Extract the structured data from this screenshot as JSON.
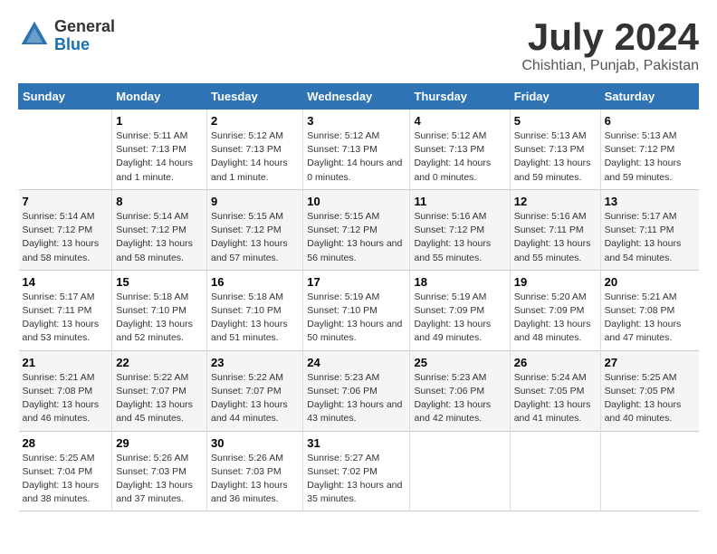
{
  "logo": {
    "general": "General",
    "blue": "Blue"
  },
  "title": {
    "month": "July 2024",
    "location": "Chishtian, Punjab, Pakistan"
  },
  "headers": [
    "Sunday",
    "Monday",
    "Tuesday",
    "Wednesday",
    "Thursday",
    "Friday",
    "Saturday"
  ],
  "weeks": [
    [
      {
        "num": "",
        "sunrise": "",
        "sunset": "",
        "daylight": ""
      },
      {
        "num": "1",
        "sunrise": "Sunrise: 5:11 AM",
        "sunset": "Sunset: 7:13 PM",
        "daylight": "Daylight: 14 hours and 1 minute."
      },
      {
        "num": "2",
        "sunrise": "Sunrise: 5:12 AM",
        "sunset": "Sunset: 7:13 PM",
        "daylight": "Daylight: 14 hours and 1 minute."
      },
      {
        "num": "3",
        "sunrise": "Sunrise: 5:12 AM",
        "sunset": "Sunset: 7:13 PM",
        "daylight": "Daylight: 14 hours and 0 minutes."
      },
      {
        "num": "4",
        "sunrise": "Sunrise: 5:12 AM",
        "sunset": "Sunset: 7:13 PM",
        "daylight": "Daylight: 14 hours and 0 minutes."
      },
      {
        "num": "5",
        "sunrise": "Sunrise: 5:13 AM",
        "sunset": "Sunset: 7:13 PM",
        "daylight": "Daylight: 13 hours and 59 minutes."
      },
      {
        "num": "6",
        "sunrise": "Sunrise: 5:13 AM",
        "sunset": "Sunset: 7:12 PM",
        "daylight": "Daylight: 13 hours and 59 minutes."
      }
    ],
    [
      {
        "num": "7",
        "sunrise": "Sunrise: 5:14 AM",
        "sunset": "Sunset: 7:12 PM",
        "daylight": "Daylight: 13 hours and 58 minutes."
      },
      {
        "num": "8",
        "sunrise": "Sunrise: 5:14 AM",
        "sunset": "Sunset: 7:12 PM",
        "daylight": "Daylight: 13 hours and 58 minutes."
      },
      {
        "num": "9",
        "sunrise": "Sunrise: 5:15 AM",
        "sunset": "Sunset: 7:12 PM",
        "daylight": "Daylight: 13 hours and 57 minutes."
      },
      {
        "num": "10",
        "sunrise": "Sunrise: 5:15 AM",
        "sunset": "Sunset: 7:12 PM",
        "daylight": "Daylight: 13 hours and 56 minutes."
      },
      {
        "num": "11",
        "sunrise": "Sunrise: 5:16 AM",
        "sunset": "Sunset: 7:12 PM",
        "daylight": "Daylight: 13 hours and 55 minutes."
      },
      {
        "num": "12",
        "sunrise": "Sunrise: 5:16 AM",
        "sunset": "Sunset: 7:11 PM",
        "daylight": "Daylight: 13 hours and 55 minutes."
      },
      {
        "num": "13",
        "sunrise": "Sunrise: 5:17 AM",
        "sunset": "Sunset: 7:11 PM",
        "daylight": "Daylight: 13 hours and 54 minutes."
      }
    ],
    [
      {
        "num": "14",
        "sunrise": "Sunrise: 5:17 AM",
        "sunset": "Sunset: 7:11 PM",
        "daylight": "Daylight: 13 hours and 53 minutes."
      },
      {
        "num": "15",
        "sunrise": "Sunrise: 5:18 AM",
        "sunset": "Sunset: 7:10 PM",
        "daylight": "Daylight: 13 hours and 52 minutes."
      },
      {
        "num": "16",
        "sunrise": "Sunrise: 5:18 AM",
        "sunset": "Sunset: 7:10 PM",
        "daylight": "Daylight: 13 hours and 51 minutes."
      },
      {
        "num": "17",
        "sunrise": "Sunrise: 5:19 AM",
        "sunset": "Sunset: 7:10 PM",
        "daylight": "Daylight: 13 hours and 50 minutes."
      },
      {
        "num": "18",
        "sunrise": "Sunrise: 5:19 AM",
        "sunset": "Sunset: 7:09 PM",
        "daylight": "Daylight: 13 hours and 49 minutes."
      },
      {
        "num": "19",
        "sunrise": "Sunrise: 5:20 AM",
        "sunset": "Sunset: 7:09 PM",
        "daylight": "Daylight: 13 hours and 48 minutes."
      },
      {
        "num": "20",
        "sunrise": "Sunrise: 5:21 AM",
        "sunset": "Sunset: 7:08 PM",
        "daylight": "Daylight: 13 hours and 47 minutes."
      }
    ],
    [
      {
        "num": "21",
        "sunrise": "Sunrise: 5:21 AM",
        "sunset": "Sunset: 7:08 PM",
        "daylight": "Daylight: 13 hours and 46 minutes."
      },
      {
        "num": "22",
        "sunrise": "Sunrise: 5:22 AM",
        "sunset": "Sunset: 7:07 PM",
        "daylight": "Daylight: 13 hours and 45 minutes."
      },
      {
        "num": "23",
        "sunrise": "Sunrise: 5:22 AM",
        "sunset": "Sunset: 7:07 PM",
        "daylight": "Daylight: 13 hours and 44 minutes."
      },
      {
        "num": "24",
        "sunrise": "Sunrise: 5:23 AM",
        "sunset": "Sunset: 7:06 PM",
        "daylight": "Daylight: 13 hours and 43 minutes."
      },
      {
        "num": "25",
        "sunrise": "Sunrise: 5:23 AM",
        "sunset": "Sunset: 7:06 PM",
        "daylight": "Daylight: 13 hours and 42 minutes."
      },
      {
        "num": "26",
        "sunrise": "Sunrise: 5:24 AM",
        "sunset": "Sunset: 7:05 PM",
        "daylight": "Daylight: 13 hours and 41 minutes."
      },
      {
        "num": "27",
        "sunrise": "Sunrise: 5:25 AM",
        "sunset": "Sunset: 7:05 PM",
        "daylight": "Daylight: 13 hours and 40 minutes."
      }
    ],
    [
      {
        "num": "28",
        "sunrise": "Sunrise: 5:25 AM",
        "sunset": "Sunset: 7:04 PM",
        "daylight": "Daylight: 13 hours and 38 minutes."
      },
      {
        "num": "29",
        "sunrise": "Sunrise: 5:26 AM",
        "sunset": "Sunset: 7:03 PM",
        "daylight": "Daylight: 13 hours and 37 minutes."
      },
      {
        "num": "30",
        "sunrise": "Sunrise: 5:26 AM",
        "sunset": "Sunset: 7:03 PM",
        "daylight": "Daylight: 13 hours and 36 minutes."
      },
      {
        "num": "31",
        "sunrise": "Sunrise: 5:27 AM",
        "sunset": "Sunset: 7:02 PM",
        "daylight": "Daylight: 13 hours and 35 minutes."
      },
      {
        "num": "",
        "sunrise": "",
        "sunset": "",
        "daylight": ""
      },
      {
        "num": "",
        "sunrise": "",
        "sunset": "",
        "daylight": ""
      },
      {
        "num": "",
        "sunrise": "",
        "sunset": "",
        "daylight": ""
      }
    ]
  ]
}
